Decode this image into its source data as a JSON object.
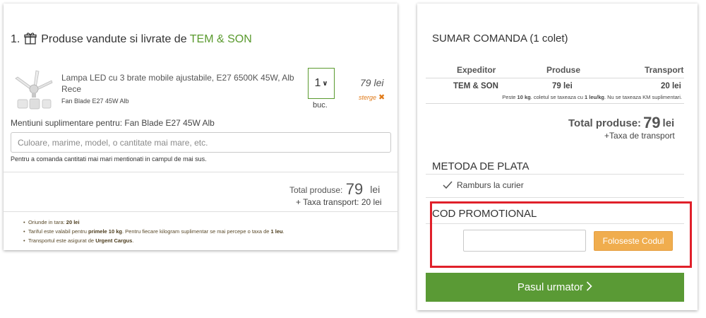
{
  "seller_section": {
    "index": "1.",
    "title_prefix": "Produse vandute si livrate de",
    "seller_name": "TEM & SON"
  },
  "product": {
    "name": "Lampa LED cu 3 brate mobile ajustabile, E27 6500K 45W, Alb Rece",
    "subtitle": "Fan Blade E27 45W Alb",
    "quantity": "1",
    "unit": "buc.",
    "price": "79 lei",
    "remove_label": "sterge"
  },
  "mentions": {
    "label": "Mentiuni suplimentare pentru: Fan Blade E27 45W Alb",
    "placeholder": "Culoare, marime, model, o cantitate mai mare, etc.",
    "value": "",
    "help": "Pentru a comanda cantitati mai mari mentionati in campul de mai sus."
  },
  "left_totals": {
    "label": "Total produse:",
    "amount": "79",
    "currency": "lei",
    "transport": "Taxa transport: 20 lei"
  },
  "notes": [
    {
      "text": "Oriunde in tara: ",
      "bold": "20 lei",
      "tail": ""
    },
    {
      "text": "Tariful este valabil pentru ",
      "bold": "primele 10 kg",
      "tail": ". Pentru fiecare kilogram suplimentar se mai percepe o taxa de ",
      "bold2": "1 leu",
      "tail2": "."
    },
    {
      "text": "Transportul este asigurat de ",
      "bold": "Urgent Cargus",
      "tail": "."
    }
  ],
  "summary": {
    "title": "SUMAR COMANDA (1 colet)",
    "headers": {
      "shipper": "Expeditor",
      "products": "Produse",
      "transport": "Transport"
    },
    "row": {
      "shipper": "TEM & SON",
      "products": "79 lei",
      "transport": "20 lei"
    },
    "note_pre": "Peste ",
    "note_b1": "10 kg",
    "note_mid": ". coletul se taxeaza cu ",
    "note_b2": "1 leu/kg",
    "note_post": ". Nu se taxeaza KM suplimentari.",
    "total_label": "Total produse:",
    "total_amount": "79",
    "total_currency": "lei",
    "transport_line": "Taxa de transport"
  },
  "payment": {
    "title": "METODA DE PLATA",
    "option": "Ramburs la curier"
  },
  "promo": {
    "title": "COD PROMOTIONAL",
    "input_value": "",
    "button_label": "Foloseste Codul"
  },
  "next_button": {
    "label": "Pasul urmator"
  },
  "colors": {
    "green_accent": "#5a9a2e",
    "next_button": "#5a9a35",
    "promo_button": "#f0ad4e",
    "remove_link": "#e07a18",
    "highlight": "#e0202a"
  }
}
